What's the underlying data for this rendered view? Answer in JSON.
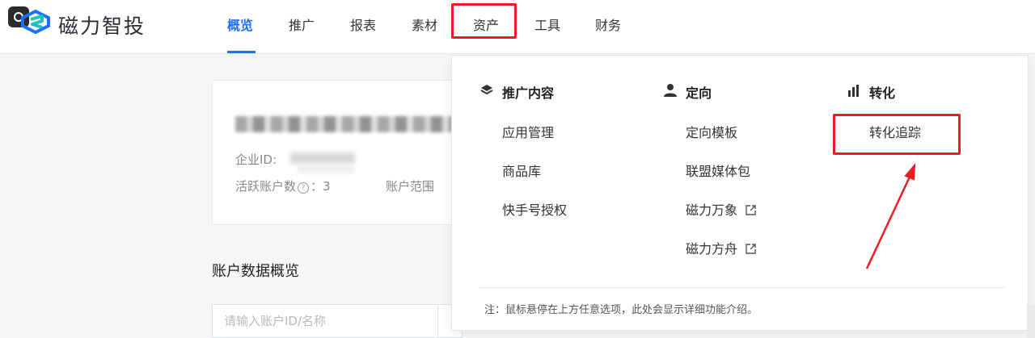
{
  "header": {
    "logo_text": "磁力智投",
    "nav": [
      {
        "label": "概览",
        "active": true
      },
      {
        "label": "推广",
        "active": false
      },
      {
        "label": "报表",
        "active": false
      },
      {
        "label": "素材",
        "active": false
      },
      {
        "label": "资产",
        "active": false,
        "highlighted": true
      },
      {
        "label": "工具",
        "active": false
      },
      {
        "label": "财务",
        "active": false
      }
    ]
  },
  "account_card": {
    "enterprise_id_label": "企业ID:",
    "active_accounts_label": "活跃账户数",
    "active_accounts_help": "?",
    "active_accounts_value": "：3",
    "account_scope_label": "账户范围"
  },
  "section": {
    "title": "账户数据概览",
    "search_placeholder": "请输入账户ID/名称"
  },
  "dropdown": {
    "columns": [
      {
        "title": "推广内容",
        "icon": "layers-icon",
        "items": [
          {
            "label": "应用管理"
          },
          {
            "label": "商品库"
          },
          {
            "label": "快手号授权"
          }
        ]
      },
      {
        "title": "定向",
        "icon": "user-icon",
        "items": [
          {
            "label": "定向模板"
          },
          {
            "label": "联盟媒体包"
          },
          {
            "label": "磁力万象",
            "external": true
          },
          {
            "label": "磁力方舟",
            "external": true
          }
        ]
      },
      {
        "title": "转化",
        "icon": "bar-chart-icon",
        "items": [
          {
            "label": "转化追踪",
            "highlighted": true
          }
        ]
      }
    ],
    "note": "注：鼠标悬停在上方任意选项，此处会显示详细功能介绍。"
  },
  "colors": {
    "accent": "#1f6fff",
    "annotation_red": "#ec1c24"
  }
}
